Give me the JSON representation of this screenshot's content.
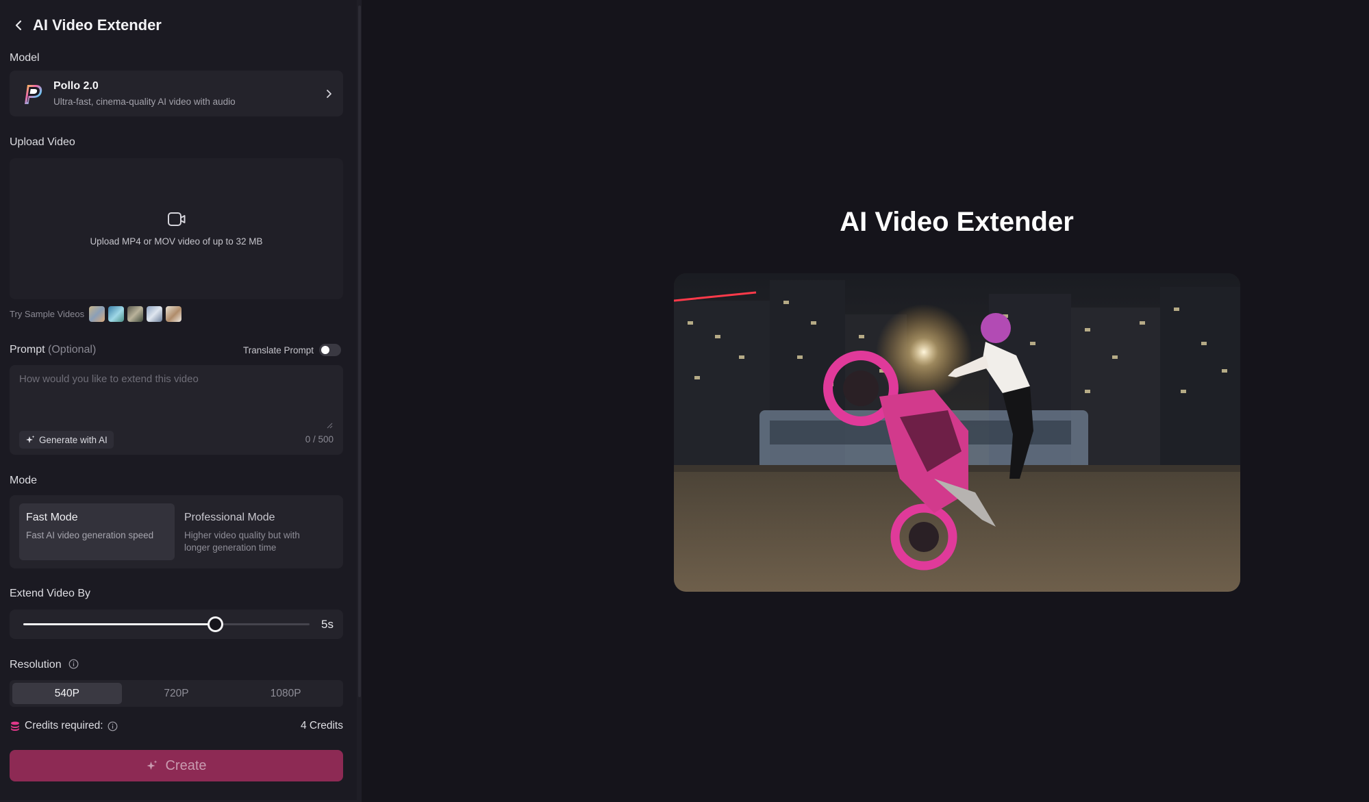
{
  "header": {
    "title": "AI Video Extender"
  },
  "model": {
    "section_label": "Model",
    "name": "Pollo 2.0",
    "description": "Ultra-fast, cinema-quality AI video with audio"
  },
  "upload": {
    "section_label": "Upload Video",
    "hint": "Upload MP4 or MOV video of up to 32 MB",
    "samples_label": "Try Sample Videos"
  },
  "prompt": {
    "label": "Prompt",
    "optional": "(Optional)",
    "translate_label": "Translate Prompt",
    "translate_on": false,
    "placeholder": "How would you like to extend this video",
    "value": "",
    "generate_label": "Generate with AI",
    "char_count": "0 / 500"
  },
  "mode": {
    "section_label": "Mode",
    "options": [
      {
        "title": "Fast Mode",
        "desc": "Fast AI video generation speed",
        "selected": true
      },
      {
        "title": "Professional Mode",
        "desc": "Higher video quality but with longer generation time",
        "selected": false
      }
    ]
  },
  "extend": {
    "section_label": "Extend Video By",
    "value_label": "5s",
    "fraction": 0.67
  },
  "resolution": {
    "section_label": "Resolution",
    "options": [
      "540P",
      "720P",
      "1080P"
    ],
    "selected": "540P"
  },
  "credits": {
    "label": "Credits required:",
    "value": "4 Credits"
  },
  "create": {
    "label": "Create"
  },
  "main": {
    "title": "AI Video Extender"
  },
  "colors": {
    "background": "#15141b",
    "panel": "#1b1a22",
    "card": "#24232b",
    "create_button": "#8d2a54",
    "accent_pink": "#e0388a"
  },
  "icons": {
    "back": "chevron-left-icon",
    "model_arrow": "chevron-right-icon",
    "upload": "video-camera-icon",
    "generate": "sparkle-icon",
    "info": "info-icon",
    "credits": "coin-stack-icon",
    "create": "sparkle-icon"
  }
}
